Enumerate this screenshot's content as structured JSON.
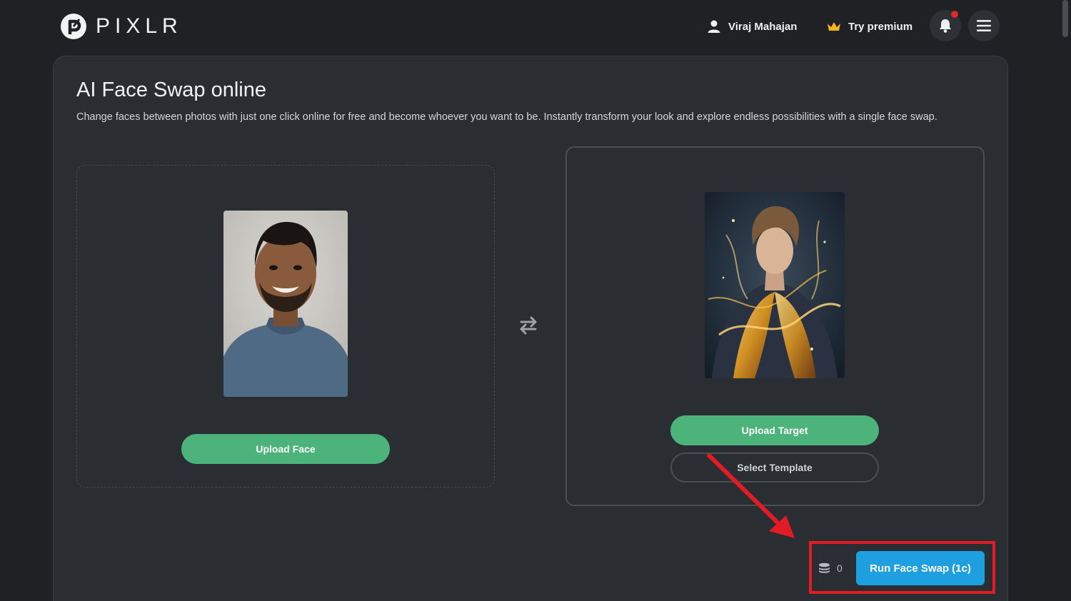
{
  "header": {
    "logo_text": "PIXLR",
    "user_name": "Viraj Mahajan",
    "premium_label": "Try premium"
  },
  "main": {
    "title": "AI Face Swap online",
    "subtitle": "Change faces between photos with just one click online for free and become whoever you want to be. Instantly transform your look and explore endless possibilities with a single face swap.",
    "face_panel": {
      "upload_label": "Upload Face"
    },
    "target_panel": {
      "upload_label": "Upload Target",
      "template_label": "Select Template"
    },
    "credits_count": "0",
    "run_label": "Run Face Swap (1c)"
  },
  "colors": {
    "background": "#1f2124",
    "card": "#2a2d31",
    "green_button": "#4cb37a",
    "run_button": "#1e9fe0",
    "highlight": "#e21b24",
    "crown": "#f3b51a"
  },
  "icons": [
    "pixlr-logo-icon",
    "user-icon",
    "crown-icon",
    "bell-icon",
    "hamburger-menu-icon",
    "swap-arrows-icon",
    "coins-icon"
  ]
}
